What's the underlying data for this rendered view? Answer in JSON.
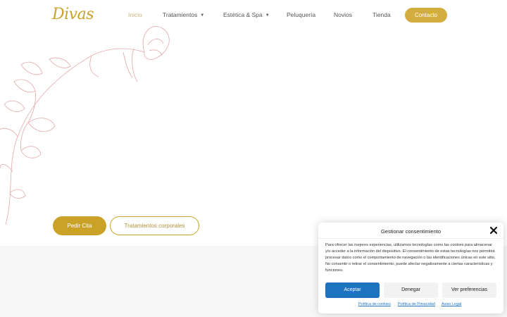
{
  "header": {
    "logo_text": "Divas",
    "nav": [
      {
        "label": "Inicio"
      },
      {
        "label": "Tratamientos",
        "dropdown": true
      },
      {
        "label": "Estética & Spa",
        "dropdown": true
      },
      {
        "label": "Peluquería"
      },
      {
        "label": "Novios"
      },
      {
        "label": "Tienda"
      }
    ],
    "contact_label": "Contacto"
  },
  "hero": {
    "primary_button": "Pedir Cita",
    "secondary_button": "Tratamientos corporales"
  },
  "consent": {
    "title": "Gestionar consentimiento",
    "body": "Para ofrecer las mejores experiencias, utilizamos tecnologías como las cookies para almacenar y/o acceder a la información del dispositivo. El consentimiento de estas tecnologías nos permitirá procesar datos como el comportamiento de navegación o las identificaciones únicas en este sitio. No consentir o retirar el consentimiento, puede afectar negativamente a ciertas características y funciones.",
    "accept_label": "Aceptar",
    "deny_label": "Denegar",
    "prefs_label": "Ver preferencias",
    "links": [
      "Política de cookies",
      "Política de Privacidad",
      "Aviso Legal"
    ]
  },
  "colors": {
    "gold": "#c9a227",
    "accent_blue": "#1e73be",
    "flower_line": "#e2a9a9"
  }
}
